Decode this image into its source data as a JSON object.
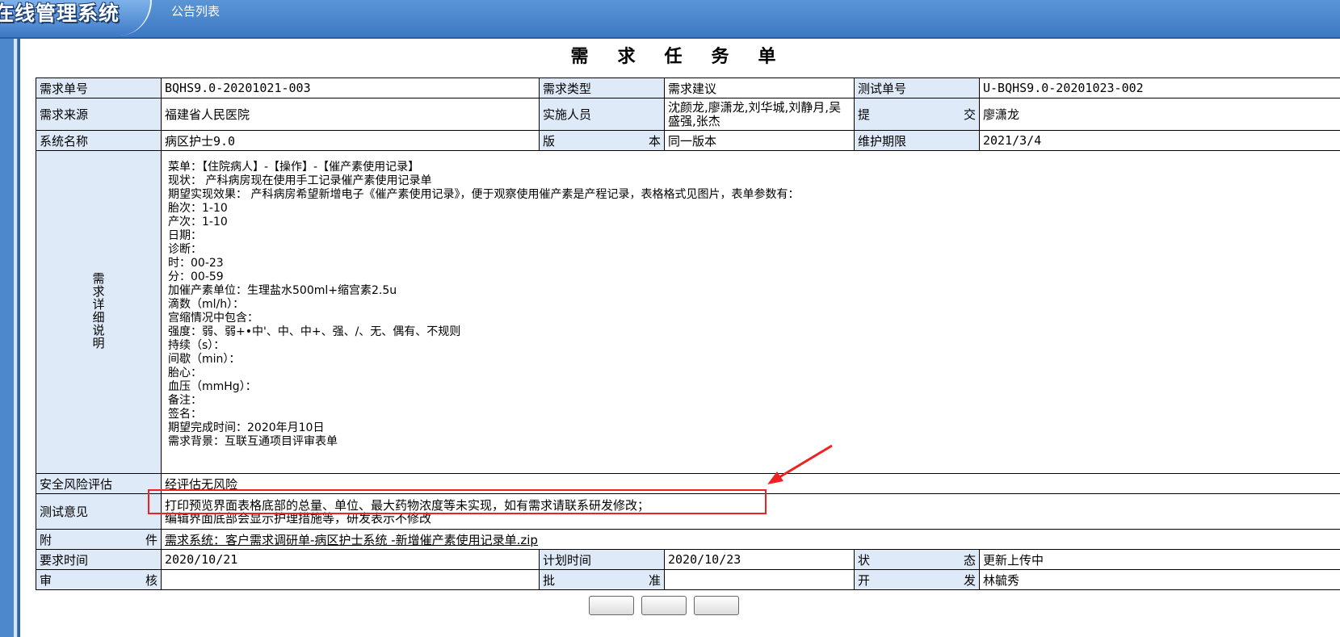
{
  "header": {
    "app_title": "在线管理系统",
    "tab_label": "公告列表"
  },
  "form": {
    "title": "需求任务单",
    "rows": {
      "req_no_label": "需求单号",
      "req_no_value": "BQHS9.0-20201021-003",
      "req_type_label": "需求类型",
      "req_type_value": "需求建议",
      "test_no_label": "测试单号",
      "test_no_value": "U-BQHS9.0-20201023-002",
      "source_label": "需求来源",
      "source_value": "福建省人民医院",
      "impl_label": "实施人员",
      "impl_value": "沈颜龙,廖潇龙,刘华城,刘静月,吴盛强,张杰",
      "submit_label": "提交",
      "submit_value": "廖潇龙",
      "system_label": "系统名称",
      "system_value": "病区护士9.0",
      "version_label": "版本",
      "version_value": "同一版本",
      "maint_label": "维护期限",
      "maint_value": "2021/3/4",
      "detail_label": "需求详细说明",
      "detail_lines": [
        "菜单：【住院病人】-【操作】-【催产素使用记录】",
        "现状：   产科病房现在使用手工记录催产素使用记录单",
        "期望实现效果：  产科病房希望新增电子《催产素使用记录》，便于观察使用催产素是产程记录，表格格式见图片，表单参数有：",
        "胎次：1-10",
        "产次：1-10",
        "日期：",
        "诊断：",
        "时：00-23",
        "分：00-59",
        "加催产素单位：生理盐水500ml+缩宫素2.5u",
        "滴数（ml/h）：",
        "宫缩情况中包含：",
        "强度：弱、弱+•中'、中、中+、强、/、无、偶有、不规则",
        "持续（s）：",
        "间歇（min）：",
        "胎心：",
        "血压（mmHg）：",
        "备注：",
        "签名：",
        "期望完成时间：2020年月10日",
        "需求背景：互联互通项目评审表单"
      ],
      "risk_label": "安全风险评估",
      "risk_value": "经评估无风险",
      "test_opinion_label": "测试意见",
      "test_opinion_line1": "打印预览界面表格底部的总量、单位、最大药物浓度等未实现，如有需求请联系研发修改；",
      "test_opinion_line2": "编辑界面底部会显示护理措施等，研发表示不修改",
      "attach_label": "附件",
      "attach_value": "需求系统：客户需求调研单-病区护士系统 -新增催产素使用记录单.zip",
      "req_time_label": "要求时间",
      "req_time_value": "2020/10/21",
      "plan_time_label": "计划时间",
      "plan_time_value": "2020/10/23",
      "status_label": "状态",
      "status_value": "更新上传中",
      "audit_label": "审核",
      "audit_value": "",
      "approve_label": "批准",
      "approve_value": "",
      "dev_label": "开发",
      "dev_value": "林毓秀"
    }
  },
  "colors": {
    "header_blue": "#3d78c4",
    "label_bg": "#dfeaf8",
    "link_blue": "#2222dd",
    "status_red": "#ff0000",
    "annotation_red": "#ee2222"
  }
}
